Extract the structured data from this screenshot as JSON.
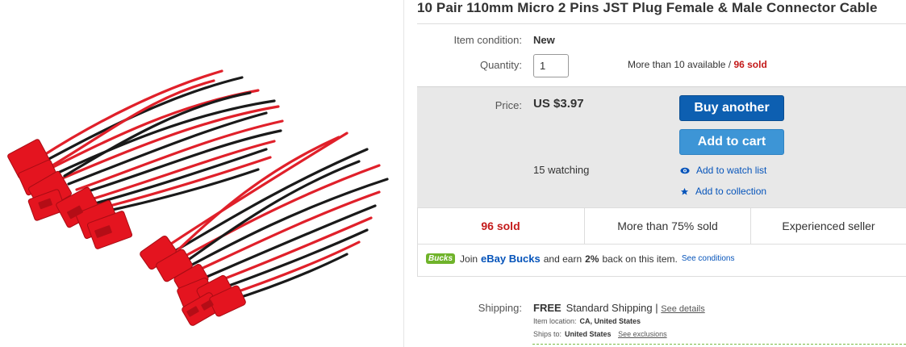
{
  "title": "10 Pair 110mm Micro 2 Pins JST Plug Female & Male Connector Cable",
  "condition": {
    "label": "Item condition:",
    "value": "New"
  },
  "quantity": {
    "label": "Quantity:",
    "value": "1",
    "available": "More than 10 available",
    "separator": "/",
    "sold": "96 sold"
  },
  "price": {
    "label": "Price:",
    "value": "US $3.97"
  },
  "buttons": {
    "buy_another": "Buy another",
    "add_to_cart": "Add to cart"
  },
  "watching": "15 watching",
  "links": {
    "watch_list": "Add to watch list",
    "collection": "Add to collection"
  },
  "stats": {
    "sold": "96 sold",
    "percent_sold": "More than 75% sold",
    "seller": "Experienced seller"
  },
  "bucks": {
    "logo": "Bucks",
    "join": "Join",
    "ebay_bucks": "eBay Bucks",
    "earn": "and earn",
    "percent": "2%",
    "back": "back on this item.",
    "conditions": "See conditions"
  },
  "shipping": {
    "label": "Shipping:",
    "free": "FREE",
    "method": "Standard Shipping",
    "sep": "|",
    "details": "See details",
    "location_label": "Item location:",
    "location_value": "CA, United States",
    "ships_to_label": "Ships to:",
    "ships_to_value": "United States",
    "exclusions": "See exclusions"
  },
  "colors": {
    "sold_red": "#c41a1a",
    "buy_blue": "#0d5fb1",
    "cart_blue": "#3d95d6",
    "link_blue": "#0654ba",
    "price_box": "#e8e8e8",
    "bucks_green": "#6fb32a"
  },
  "icons": {
    "watch": "eye-icon",
    "collection": "star-icon"
  }
}
